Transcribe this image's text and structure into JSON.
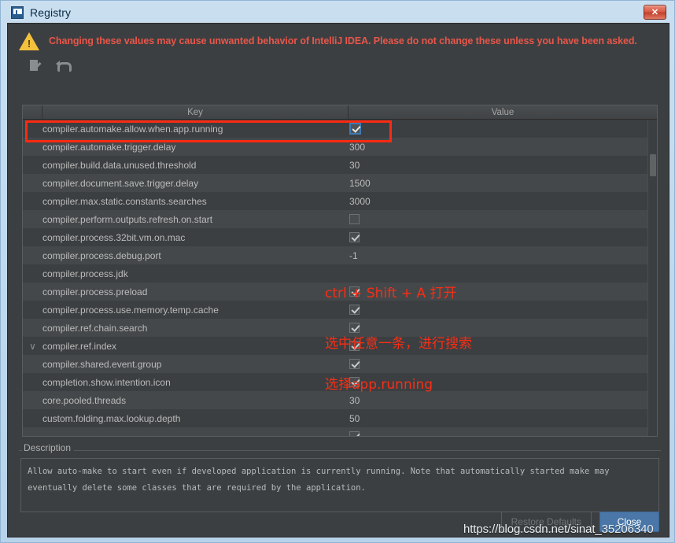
{
  "window": {
    "title": "Registry",
    "icon": "intellij-idea-icon",
    "close_label": "✕"
  },
  "warning": {
    "icon": "warning-triangle-icon",
    "text": "Changing these values may cause unwanted behavior of IntelliJ IDEA. Please do not change these unless you have been asked."
  },
  "toolbar": {
    "items": [
      {
        "name": "edit-value-icon",
        "tooltip": "Edit value"
      },
      {
        "name": "revert-icon",
        "tooltip": "Revert to default"
      }
    ]
  },
  "table": {
    "columns": [
      "",
      "Key",
      "Value"
    ],
    "rows": [
      {
        "marker": "",
        "key": "compiler.automake.allow.when.app.running",
        "value_type": "checkbox",
        "checked": true,
        "focused": true,
        "highlighted": true
      },
      {
        "marker": "",
        "key": "compiler.automake.trigger.delay",
        "value_type": "text",
        "value": "300"
      },
      {
        "marker": "",
        "key": "compiler.build.data.unused.threshold",
        "value_type": "text",
        "value": "30"
      },
      {
        "marker": "",
        "key": "compiler.document.save.trigger.delay",
        "value_type": "text",
        "value": "1500"
      },
      {
        "marker": "",
        "key": "compiler.max.static.constants.searches",
        "value_type": "text",
        "value": "3000"
      },
      {
        "marker": "",
        "key": "compiler.perform.outputs.refresh.on.start",
        "value_type": "checkbox",
        "checked": false
      },
      {
        "marker": "",
        "key": "compiler.process.32bit.vm.on.mac",
        "value_type": "checkbox",
        "checked": true
      },
      {
        "marker": "",
        "key": "compiler.process.debug.port",
        "value_type": "text",
        "value": "-1"
      },
      {
        "marker": "",
        "key": "compiler.process.jdk",
        "value_type": "text",
        "value": ""
      },
      {
        "marker": "",
        "key": "compiler.process.preload",
        "value_type": "checkbox",
        "checked": true
      },
      {
        "marker": "",
        "key": "compiler.process.use.memory.temp.cache",
        "value_type": "checkbox",
        "checked": true
      },
      {
        "marker": "",
        "key": "compiler.ref.chain.search",
        "value_type": "checkbox",
        "checked": true
      },
      {
        "marker": "∨",
        "key": "compiler.ref.index",
        "value_type": "checkbox",
        "checked": true
      },
      {
        "marker": "",
        "key": "compiler.shared.event.group",
        "value_type": "checkbox",
        "checked": true
      },
      {
        "marker": "",
        "key": "completion.show.intention.icon",
        "value_type": "checkbox",
        "checked": true
      },
      {
        "marker": "",
        "key": "core.pooled.threads",
        "value_type": "text",
        "value": "30"
      },
      {
        "marker": "",
        "key": "custom.folding.max.lookup.depth",
        "value_type": "text",
        "value": "50"
      },
      {
        "marker": "",
        "key": "",
        "value_type": "checkbox",
        "checked": true
      }
    ]
  },
  "annotations": [
    {
      "text": "ctrl + Shift + A 打开",
      "color": "#fb2d14"
    },
    {
      "text": "选中任意一条，进行搜索",
      "color": "#fb2d14"
    },
    {
      "text": "选择app.running",
      "color": "#fb2d14"
    }
  ],
  "description": {
    "legend": "Description",
    "text": "Allow auto-make to start even if developed application is currently running. Note that automatically started make may eventually delete some classes that are required by the application."
  },
  "footer": {
    "restore_label": "Restore Defaults",
    "close_label": "Close"
  },
  "watermark": {
    "text": "https://blog.csdn.net/sinat_35206340"
  },
  "colors": {
    "accent_blue": "#4a77a8",
    "warning_red": "#e8564a",
    "annotation_red": "#fb2d14",
    "highlight_box": "#fa2a12",
    "panel_bg": "#3c3f41",
    "row_alt_bg": "#45484a",
    "frame_blue": "#a8c8e4"
  }
}
